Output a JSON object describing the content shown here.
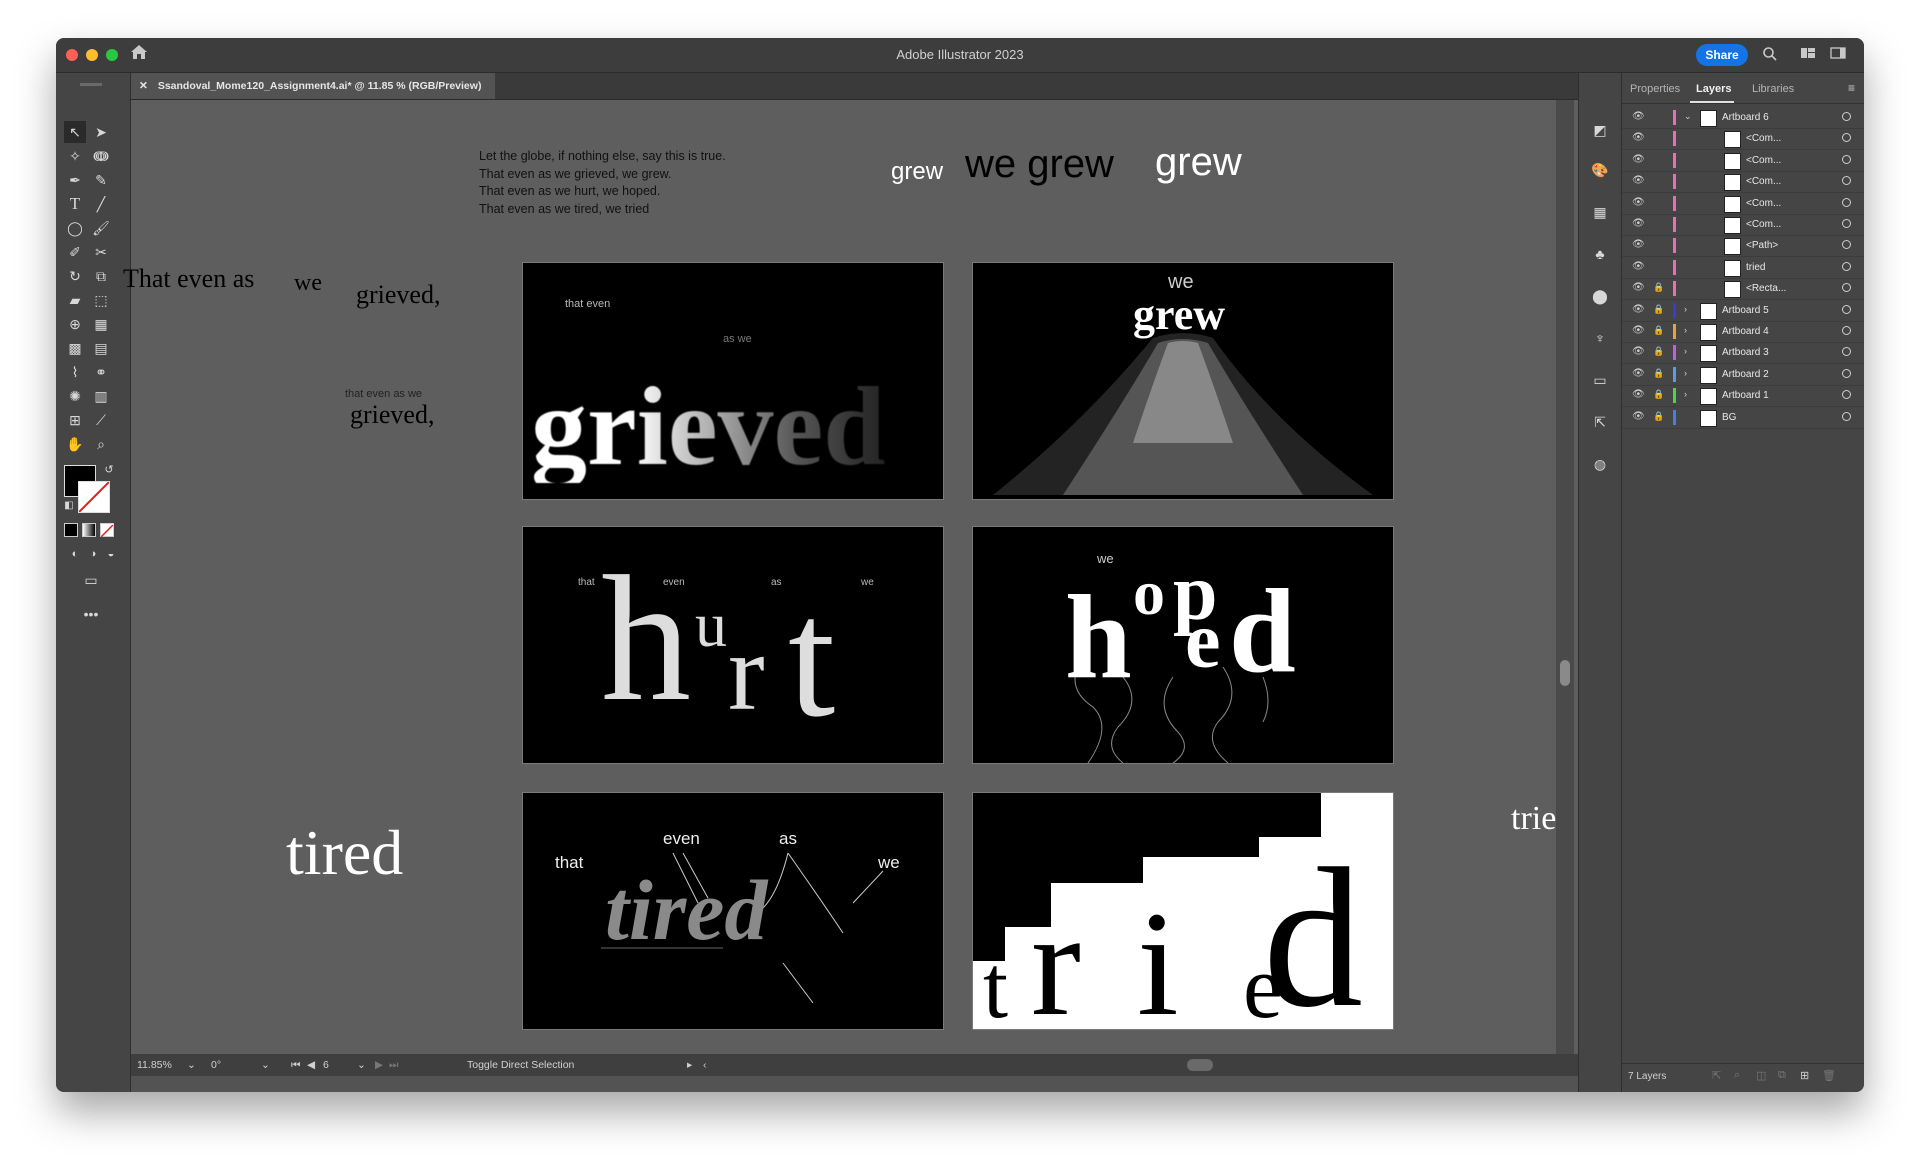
{
  "window": {
    "title": "Adobe Illustrator 2023"
  },
  "titlebar": {
    "share_label": "Share"
  },
  "document": {
    "tab_label": "Ssandoval_Mome120_Assignment4.ai* @ 11.85 % (RGB/Preview)"
  },
  "canvas": {
    "poem_lines": [
      "Let the globe, if nothing else, say this is true.",
      "That even as we grieved, we grew.",
      "That even as we hurt, we hoped.",
      "That even as we tired, we tried"
    ],
    "grew_small": "grew",
    "we_grew": "we grew",
    "grew_big": "grew",
    "that_even_as": "That even as",
    "we": "we",
    "grieved_1": "grieved,",
    "that_even_as_we_small": "that even as we",
    "grieved_2": "grieved,",
    "tired": "tired",
    "tried": "tried"
  },
  "artboards": {
    "a1": {
      "that_even": "that  even",
      "as_we": "as we",
      "word": "grieved"
    },
    "a2": {
      "we": "we",
      "word": "grew"
    },
    "a3": {
      "that": "that",
      "even": "even",
      "as": "as",
      "we": "we",
      "h": "h",
      "u": "u",
      "r": "r",
      "t": "t"
    },
    "a4": {
      "we": "we",
      "h": "h",
      "o": "o",
      "p": "p",
      "e": "e",
      "d": "d"
    },
    "a5": {
      "that": "that",
      "even": "even",
      "as": "as",
      "we": "we",
      "word": "tired"
    },
    "a6": {
      "t": "t",
      "r": "r",
      "i": "i",
      "e": "e",
      "d": "d"
    }
  },
  "statusbar": {
    "zoom": "11.85%",
    "rotate": "0°",
    "artboard_num": "6",
    "tool_hint": "Toggle Direct Selection"
  },
  "panel": {
    "tabs": [
      "Properties",
      "Layers",
      "Libraries"
    ],
    "layers": [
      {
        "name": "Artboard 6",
        "color": "#e86fb3"
      },
      {
        "name": "<Com...",
        "color": "#e86fb3"
      },
      {
        "name": "<Com...",
        "color": "#e86fb3"
      },
      {
        "name": "<Com...",
        "color": "#e86fb3"
      },
      {
        "name": "<Com...",
        "color": "#e86fb3"
      },
      {
        "name": "<Com...",
        "color": "#e86fb3"
      },
      {
        "name": "<Path>",
        "color": "#e86fb3"
      },
      {
        "name": "tried",
        "color": "#e86fb3"
      },
      {
        "name": "<Recta...",
        "color": "#e86fb3"
      },
      {
        "name": "Artboard 5",
        "color": "#3a3ad8"
      },
      {
        "name": "Artboard 4",
        "color": "#e8a23a"
      },
      {
        "name": "Artboard 3",
        "color": "#c060e0"
      },
      {
        "name": "Artboard 2",
        "color": "#5a9ae8"
      },
      {
        "name": "Artboard 1",
        "color": "#4ad84a"
      },
      {
        "name": "BG",
        "color": "#4a7ae8"
      }
    ],
    "layer_count": "7 Layers"
  }
}
